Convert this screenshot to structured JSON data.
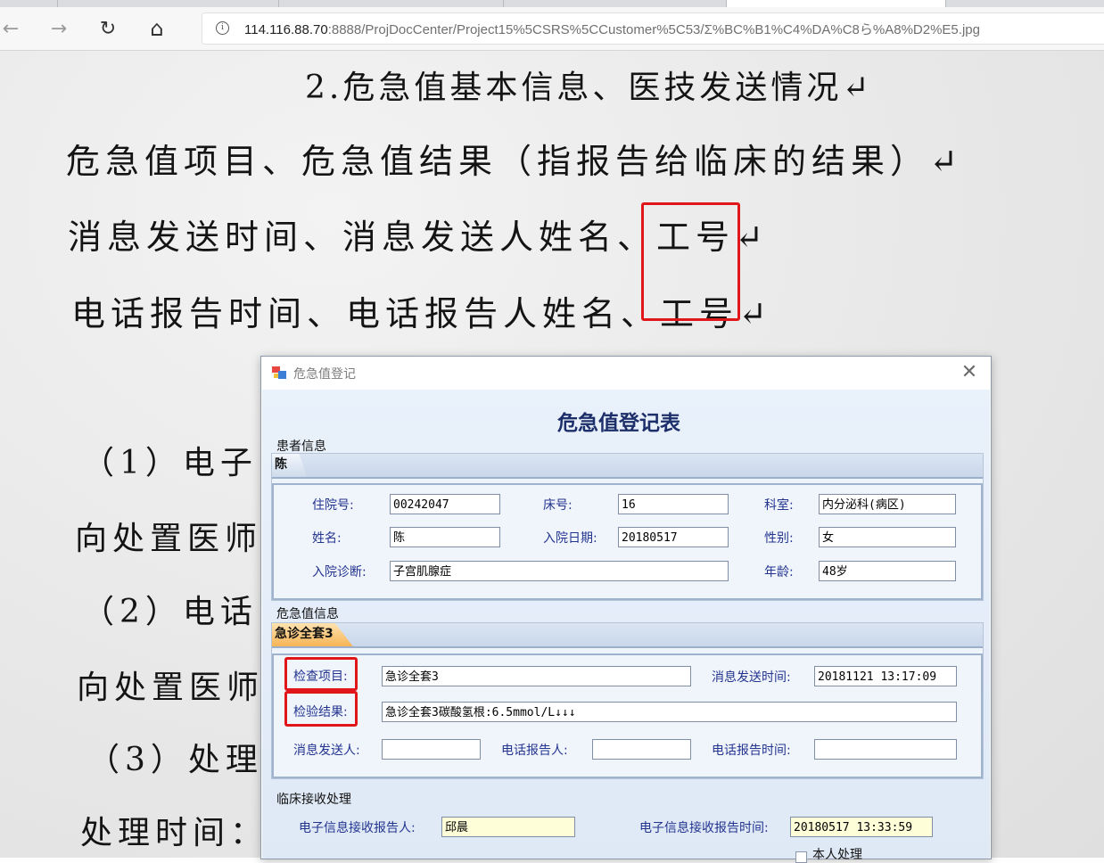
{
  "browser": {
    "url_host": "114.116.88.70",
    "url_rest": ":8888/ProjDocCenter/Project15%5CSRS%5CCustomer%5C53/Σ%BC%B1%C4%DA%C8ら%A8%D2%E5.jpg",
    "info_glyph": "i",
    "back_glyph": "←",
    "forward_glyph": "→",
    "reload_glyph": "↻",
    "home_glyph": "⌂"
  },
  "scan": {
    "heading": "2.危急值基本信息、医技发送情况↵",
    "line1": "危急值项目、危急值结果（指报告给临床的结果）↵",
    "line2": "消息发送时间、消息发送人姓名、工号↵",
    "line3": "电话报告时间、电话报告人姓名、工号↵",
    "item1": "（1）电子",
    "line_send1": "向处置医师",
    "item2": "（2）电话",
    "line_send2": "向处置医师",
    "item3": "（3）处理",
    "line_time": "处理时间："
  },
  "dialog": {
    "window_title": "危急值登记",
    "close_glyph": "✕",
    "form_title": "危急值登记表",
    "patient_section": "患者信息",
    "patient_tab": "陈",
    "patient": {
      "admission_no_label": "住院号:",
      "admission_no": "00242047",
      "bed_label": "床号:",
      "bed": "16",
      "dept_label": "科室:",
      "dept": "内分泌科(病区)",
      "name_label": "姓名:",
      "name": "陈",
      "admit_date_label": "入院日期:",
      "admit_date": "20180517",
      "gender_label": "性别:",
      "gender": "女",
      "diagnosis_label": "入院诊断:",
      "diagnosis": "子宫肌腺症",
      "age_label": "年龄:",
      "age": "48岁"
    },
    "critical_section": "危急值信息",
    "critical_tab": "急诊全套3",
    "critical": {
      "item_label": "检查项目:",
      "item": "急诊全套3",
      "send_time_label": "消息发送时间:",
      "send_time": "20181121 13:17:09",
      "result_label": "检验结果:",
      "result": "急诊全套3碳酸氢根:6.5mmol/L↓↓↓",
      "sender_label": "消息发送人:",
      "sender": "",
      "phone_reporter_label": "电话报告人:",
      "phone_reporter": "",
      "phone_time_label": "电话报告时间:",
      "phone_time": ""
    },
    "clinical_section": "临床接收处理",
    "clinical": {
      "receiver_label": "电子信息接收报告人:",
      "receiver": "邱晨",
      "receive_time_label": "电子信息接收报告时间:",
      "receive_time": "20180517 13:33:59",
      "self_handle_label": "本人处理"
    }
  },
  "colors": {
    "highlight_red": "#e0161a",
    "form_title": "#1d2f6b",
    "label_blue": "#23348f",
    "orange_tab": "#f6b455"
  }
}
